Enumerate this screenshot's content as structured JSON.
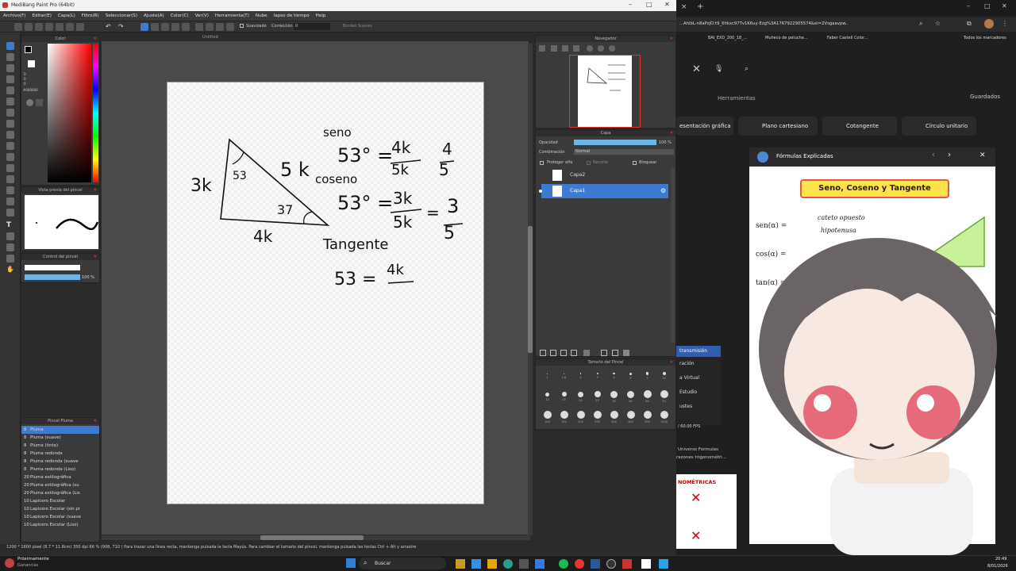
{
  "window": {
    "title": "MediBang Paint Pro (64bit)"
  },
  "menu": [
    "Archivo(F)",
    "Editar(E)",
    "Capa(L)",
    "Filtro(R)",
    "Seleccionar(S)",
    "Ajuste(A)",
    "Color(C)",
    "Ver(V)",
    "Herramienta(T)",
    "Nube",
    "lapso de tiempo",
    "Help"
  ],
  "toolbar": {
    "antialias": "Suavizado",
    "correction": "Corrección",
    "correction_value": "0",
    "soft_edges": "Bordes Suaves"
  },
  "canvas_title": "Untitled",
  "panels": {
    "color": "Color",
    "brush_preview": "Vista previa del pincel",
    "brush_control": "Control del pincel",
    "brush_control_value": "100 %",
    "navigator": "Navegador",
    "layer": "Capa",
    "brush_size": "Tamaño del Pincel",
    "brush_list": "Pincel Pluma"
  },
  "color_values": {
    "hex": "#000000",
    "r": "0",
    "g": "0",
    "b": "0"
  },
  "layers": {
    "opacity_label": "Opacidad",
    "opacity_value": "100 %",
    "blend_label": "Combinación",
    "blend_value": "Normal",
    "protect_alpha": "Proteger alfa",
    "clipping": "Recorte",
    "lock": "Bloquear",
    "items": [
      {
        "name": "Capa2"
      },
      {
        "name": "Capa1"
      }
    ]
  },
  "brush_sizes_row1": [
    "1",
    "1.6",
    "2",
    "3",
    "4",
    "5",
    "7",
    "10"
  ],
  "brush_sizes_row2": [
    "12",
    "15",
    "20",
    "25",
    "30",
    "40",
    "50",
    "70"
  ],
  "brush_sizes_row3": [
    "100",
    "150",
    "200",
    "250",
    "300",
    "400",
    "500",
    "1000"
  ],
  "brushes": [
    {
      "size": "8",
      "name": "Pluma"
    },
    {
      "size": "8",
      "name": "Pluma (suave)"
    },
    {
      "size": "8",
      "name": "Pluma (tinta)"
    },
    {
      "size": "8",
      "name": "Pluma redonda"
    },
    {
      "size": "8",
      "name": "Pluma redonda (suave"
    },
    {
      "size": "8",
      "name": "Pluma redonda (Liso)"
    },
    {
      "size": "20",
      "name": "Pluma estilográfica"
    },
    {
      "size": "20",
      "name": "Pluma estilográfica (su"
    },
    {
      "size": "20",
      "name": "Pluma estilográfica (Lis"
    },
    {
      "size": "10",
      "name": "Lapicero Escolar"
    },
    {
      "size": "10",
      "name": "Lapicero Escolar (sin pr"
    },
    {
      "size": "10",
      "name": "Lapicero Escolar (suave"
    },
    {
      "size": "10",
      "name": "Lapicero Escolar (Liso)"
    }
  ],
  "drawing": {
    "seno": "seno",
    "coseno": "coseno",
    "tangente": "Tangente",
    "eq1": "53° =",
    "eq1_num": "4k",
    "eq1_den": "5k",
    "eq1_frac_num": "4",
    "eq1_frac_den": "5",
    "eq2": "53° =",
    "eq2_num": "3k",
    "eq2_den": "5k",
    "eq2_eq": "=",
    "eq2_frac_num": "3",
    "eq2_frac_den": "5",
    "eq3": "53 =",
    "eq3_num": "4k",
    "side_hyp": "5 k",
    "side_left": "3k",
    "side_bottom": "4k",
    "angle_top": "53",
    "angle_bottom": "37"
  },
  "status": {
    "size": "1200 * 1600 pixel",
    "dims": "(8.7 * 11.8cm)",
    "dpi": "350 dpi",
    "zoom": "66 %",
    "coords": "(908, 710 )",
    "hint": "Para trazar una línea recta, mantenga pulsada la tecla Mayús. Para cambiar el tamaño del pincel, mantenga pulsada las teclas Ctrl + Alt y arrastre"
  },
  "browser": {
    "url": "...AhlbL-n8aPzJO:t9_6hkxc97Tv1K6uy-Ezg%3A1767922905574&ei=2Vsgaavpw..",
    "bookmarks": [
      "BAI_EXD_200_18_...",
      "Muñeco de peluche...",
      "Faber Castell Color..."
    ],
    "all_bookmarks": "Todos los marcadores",
    "tools": "Herramientas",
    "saved": "Guardados",
    "chips": [
      "esentación gráfica",
      "Plano cartesiano",
      "Cotangente",
      "Círculo unitario"
    ],
    "card_title": "Fórmulas Explicadas",
    "banner": "Seno, Coseno y Tangente",
    "formula1": "sen(α) =",
    "formula1_num": "cateto opuesto",
    "formula1_den": "hipotenusa",
    "formula2": "cos(α) =",
    "formula3": "tan(α) =",
    "side_items": [
      "transmisión",
      "ración",
      "a Virtual",
      "Estudio",
      "ustes"
    ],
    "fps": "/ 60.00 FPS",
    "related1": "Universo Formulas",
    "related2": "razones trigonométri...",
    "tile_label": "NOMÉTRICAS"
  },
  "taskbar": {
    "weather_title": "Próximamente",
    "weather_sub": "Ganancias",
    "search": "Buscar",
    "time": "20:49",
    "date": "8/01/2026"
  }
}
